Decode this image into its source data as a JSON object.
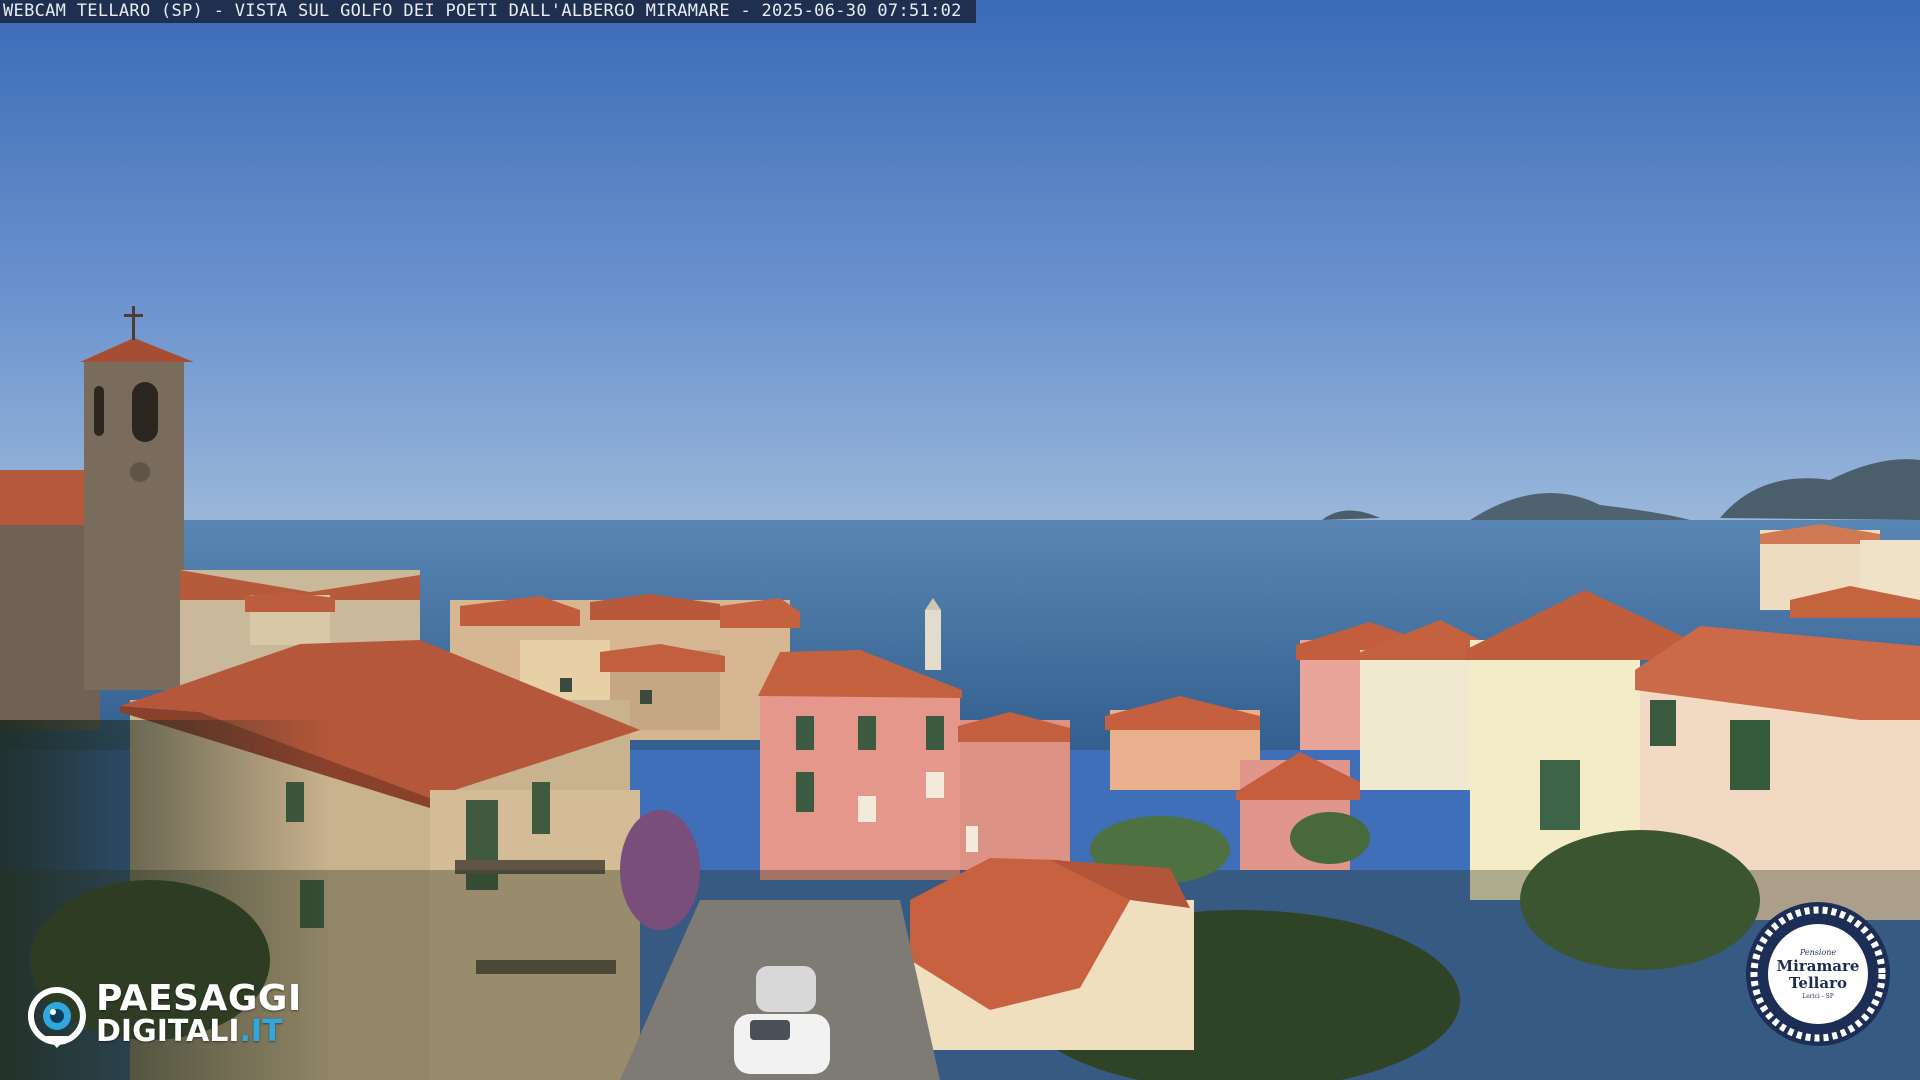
{
  "caption": {
    "text": "WEBCAM TELLARO (SP) - VISTA SUL GOLFO DEI POETI DALL'ALBERGO MIRAMARE - 2025-06-30 07:51:02"
  },
  "logo": {
    "brand": "PAESAGGI",
    "brand_second": "DIGITALI",
    "tld": ".IT",
    "icon": "eye-icon"
  },
  "badge": {
    "line_small": "Pensione",
    "line1": "Miramare",
    "line2": "Tellaro",
    "line_tiny": "Lerici - SP",
    "icon": "rope-ring-icon"
  },
  "colors": {
    "sky_top": "#3a6db8",
    "sky_horizon": "#8fb0d6",
    "sea": "#3d6f9e",
    "roof": "#c8603f",
    "wall_pink": "#e29a8e",
    "badge_blue": "#1c2e55"
  }
}
